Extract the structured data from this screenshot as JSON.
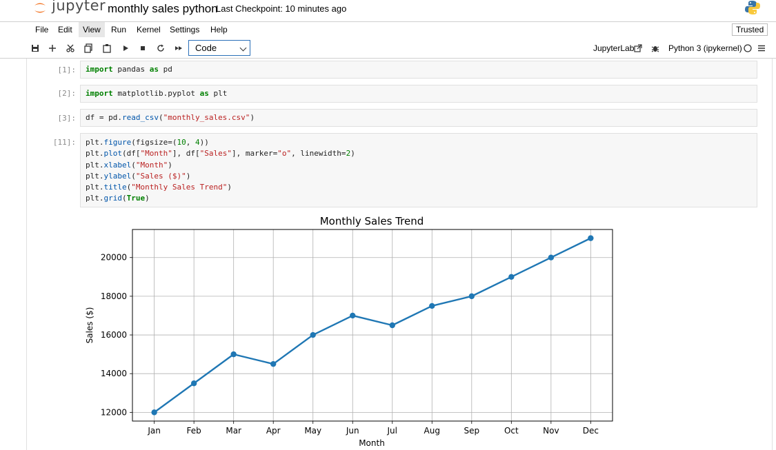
{
  "header": {
    "logo_text": "jupyter",
    "notebook_title": "monthly sales python",
    "checkpoint": "Last Checkpoint: 10 minutes ago"
  },
  "menu": {
    "items": [
      "File",
      "Edit",
      "View",
      "Run",
      "Kernel",
      "Settings",
      "Help"
    ],
    "active": "View",
    "trusted": "Trusted"
  },
  "toolbar": {
    "cell_type": "Code",
    "jupyterlab_link": "JupyterLab",
    "kernel": "Python 3 (ipykernel)"
  },
  "cells": [
    {
      "prompt": "[1]:",
      "lines": [
        [
          [
            "kw",
            "import"
          ],
          [
            "t",
            " pandas "
          ],
          [
            "kw",
            "as"
          ],
          [
            "t",
            " pd"
          ]
        ]
      ]
    },
    {
      "prompt": "[2]:",
      "lines": [
        [
          [
            "kw",
            "import"
          ],
          [
            "t",
            " matplotlib.pyplot "
          ],
          [
            "kw",
            "as"
          ],
          [
            "t",
            " plt"
          ]
        ]
      ]
    },
    {
      "prompt": "[3]:",
      "lines": [
        [
          [
            "t",
            "df = pd."
          ],
          [
            "call",
            "read_csv"
          ],
          [
            "t",
            "("
          ],
          [
            "str",
            "\"monthly_sales.csv\""
          ],
          [
            "t",
            ")"
          ]
        ]
      ]
    },
    {
      "prompt": "[11]:",
      "lines": [
        [
          [
            "t",
            "plt."
          ],
          [
            "call",
            "figure"
          ],
          [
            "t",
            "(figsize=("
          ],
          [
            "num",
            "10"
          ],
          [
            "t",
            ", "
          ],
          [
            "num",
            "4"
          ],
          [
            "t",
            "))"
          ]
        ],
        [
          [
            "t",
            "plt."
          ],
          [
            "call",
            "plot"
          ],
          [
            "t",
            "(df["
          ],
          [
            "str",
            "\"Month\""
          ],
          [
            "t",
            "], df["
          ],
          [
            "str",
            "\"Sales\""
          ],
          [
            "t",
            "], marker="
          ],
          [
            "str",
            "\"o\""
          ],
          [
            "t",
            ", linewidth="
          ],
          [
            "num",
            "2"
          ],
          [
            "t",
            ")"
          ]
        ],
        [
          [
            "t",
            "plt."
          ],
          [
            "call",
            "xlabel"
          ],
          [
            "t",
            "("
          ],
          [
            "str",
            "\"Month\""
          ],
          [
            "t",
            ")"
          ]
        ],
        [
          [
            "t",
            "plt."
          ],
          [
            "call",
            "ylabel"
          ],
          [
            "t",
            "("
          ],
          [
            "str",
            "\"Sales ($)\""
          ],
          [
            "t",
            ")"
          ]
        ],
        [
          [
            "t",
            "plt."
          ],
          [
            "call",
            "title"
          ],
          [
            "t",
            "("
          ],
          [
            "str",
            "\"Monthly Sales Trend\""
          ],
          [
            "t",
            ")"
          ]
        ],
        [
          [
            "t",
            "plt."
          ],
          [
            "call",
            "grid"
          ],
          [
            "t",
            "("
          ],
          [
            "kw",
            "True"
          ],
          [
            "t",
            ")"
          ]
        ]
      ]
    }
  ],
  "colors": {
    "line": "#1f77b4",
    "grid": "#b0b0b0",
    "accent": "#f37626"
  },
  "chart_data": {
    "type": "line",
    "title": "Monthly Sales Trend",
    "xlabel": "Month",
    "ylabel": "Sales ($)",
    "categories": [
      "Jan",
      "Feb",
      "Mar",
      "Apr",
      "May",
      "Jun",
      "Jul",
      "Aug",
      "Sep",
      "Oct",
      "Nov",
      "Dec"
    ],
    "values": [
      12000,
      13500,
      15000,
      14500,
      16000,
      17000,
      16500,
      17500,
      18000,
      19000,
      20000,
      21000
    ],
    "yticks": [
      12000,
      14000,
      16000,
      18000,
      20000
    ],
    "ylim": [
      11550,
      21450
    ],
    "grid": true,
    "marker": "o"
  }
}
